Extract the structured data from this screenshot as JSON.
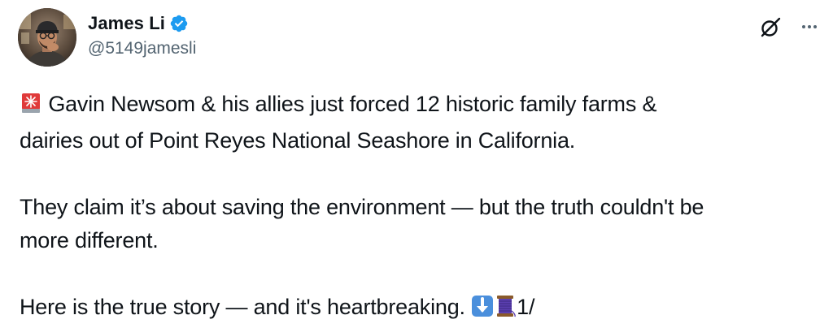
{
  "author": {
    "display_name": "James Li",
    "handle": "@5149jamesli",
    "verified": true,
    "verified_color": "#1d9bf0"
  },
  "actions": {
    "grok_icon": "grok-icon",
    "more_icon": "more-icon"
  },
  "tweet": {
    "paragraph_1_text": "Gavin Newsom & his allies just forced 12 historic family farms &\ndairies out of Point Reyes National Seashore in California.",
    "paragraph_1_emoji": "rotating-light-emoji",
    "paragraph_2": "They claim it’s about saving the environment — but the truth couldn't be\nmore different.",
    "paragraph_3_text": "Here is the true story — and it's heartbreaking.",
    "paragraph_3_emojis": [
      "down-arrow-emoji",
      "thread-spool-emoji"
    ],
    "paragraph_3_suffix": "1/"
  },
  "colors": {
    "text_primary": "#0f1419",
    "text_secondary": "#536471",
    "accent": "#1d9bf0"
  }
}
